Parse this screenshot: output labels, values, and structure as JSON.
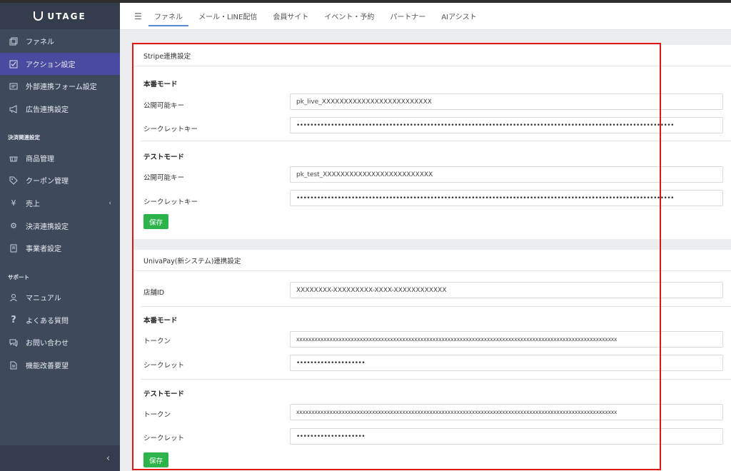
{
  "app": {
    "logo": "UTAGE"
  },
  "sidebar": {
    "items": [
      {
        "label": "ファネル",
        "icon": "layers-icon"
      },
      {
        "label": "アクション設定",
        "icon": "checklist-icon",
        "active": true
      },
      {
        "label": "外部連携フォーム設定",
        "icon": "form-icon"
      },
      {
        "label": "広告連携設定",
        "icon": "megaphone-icon"
      }
    ],
    "section_payment": "決済関連設定",
    "payment_items": [
      {
        "label": "商品管理",
        "icon": "basket-icon"
      },
      {
        "label": "クーポン管理",
        "icon": "tag-icon"
      },
      {
        "label": "売上",
        "icon": "yen-icon"
      },
      {
        "label": "決済連携設定",
        "icon": "gear-icon"
      },
      {
        "label": "事業者設定",
        "icon": "building-icon"
      }
    ],
    "section_support": "サポート",
    "support_items": [
      {
        "label": "マニュアル",
        "icon": "person-icon"
      },
      {
        "label": "よくある質問",
        "icon": "question-icon"
      },
      {
        "label": "お問い合わせ",
        "icon": "chat-icon"
      },
      {
        "label": "機能改善要望",
        "icon": "document-icon"
      }
    ],
    "collapse": "‹"
  },
  "topnav": {
    "menu_icon": "☰",
    "tabs": [
      "ファネル",
      "メール・LINE配信",
      "会員サイト",
      "イベント・予約",
      "パートナー",
      "AIアシスト"
    ]
  },
  "stripe": {
    "title": "Stripe連携設定",
    "live_title": "本番モード",
    "test_title": "テストモード",
    "public_key_label": "公開可能キー",
    "secret_key_label": "シークレットキー",
    "live_public_key": "pk_live_XXXXXXXXXXXXXXXXXXXXXXXXX",
    "live_secret_key": "••••••••••••••••••••••••••••••••••••••••••••••••••••••••••••••••••••••••••••••••••••••••••••••••••••••••••••••",
    "test_public_key": "pk_test_XXXXXXXXXXXXXXXXXXXXXXXXX",
    "test_secret_key": "••••••••••••••••••••••••••••••••••••••••••••••••••••••••••••••••••••••••••••••••••••••••••••••••••••••••••••••",
    "save": "保存"
  },
  "univapay": {
    "title": "UnivaPay(新システム)連携設定",
    "store_id_label": "店舗ID",
    "store_id": "XXXXXXXX-XXXXXXXXX-XXXX-XXXXXXXXXXXX",
    "live_title": "本番モード",
    "test_title": "テストモード",
    "token_label": "トークン",
    "secret_label": "シークレット",
    "live_token": "xxxxxxxxxxxxxxxxxxxxxxxxxxxxxxxxxxxxxxxxxxxxxxxxxxxxxxxxxxxxxxxxxxxxxxxxxxxxxxxxxxxxxxxxxxxxxxxxxxxxxxxxxx",
    "live_secret": "••••••••••••••••••••",
    "test_token": "xxxxxxxxxxxxxxxxxxxxxxxxxxxxxxxxxxxxxxxxxxxxxxxxxxxxxxxxxxxxxxxxxxxxxxxxxxxxxxxxxxxxxxxxxxxxxxxxxxxxxxxxxx",
    "test_secret": "••••••••••••••••••••",
    "save": "保存"
  },
  "colors": {
    "sidebar_bg": "#3e4a5c",
    "sidebar_active": "#4a4a9e",
    "save_button": "#2cb34a",
    "highlight": "#e01616"
  }
}
